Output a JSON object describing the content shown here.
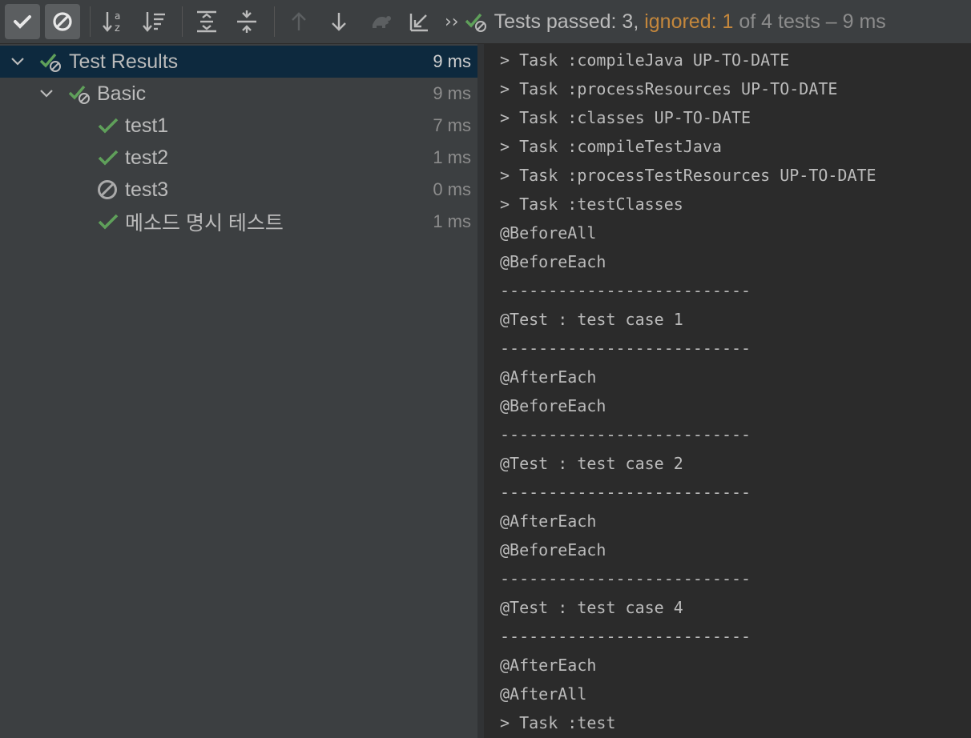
{
  "toolbar": {
    "buttons": [
      {
        "name": "show-passed-button",
        "icon": "checkmark-icon",
        "toggled": true
      },
      {
        "name": "show-ignored-button",
        "icon": "circle-slash-icon",
        "toggled": true
      },
      {
        "name": "sort-alphabetically-button",
        "icon": "sort-az-icon"
      },
      {
        "name": "sort-by-duration-button",
        "icon": "sort-duration-icon"
      },
      {
        "name": "expand-all-button",
        "icon": "expand-all-icon"
      },
      {
        "name": "collapse-all-button",
        "icon": "collapse-all-icon"
      },
      {
        "name": "previous-failed-button",
        "icon": "arrow-up-icon",
        "disabled": true
      },
      {
        "name": "next-failed-button",
        "icon": "arrow-down-icon"
      },
      {
        "name": "import-tests-button",
        "icon": "turtle-icon",
        "disabled": true
      },
      {
        "name": "export-tests-button",
        "icon": "arrow-down-left-icon"
      }
    ],
    "more_glyph": "››",
    "status": {
      "passed_text": "Tests passed: 3,",
      "ignored_text": "ignored: 1",
      "of_text": "of 4 tests –",
      "time_text": "9 ms"
    }
  },
  "tree": {
    "root": {
      "label": "Test Results",
      "time": "9 ms",
      "icon": "passed-with-ignored-icon",
      "selected": true
    },
    "suite": {
      "label": "Basic",
      "time": "9 ms",
      "icon": "passed-with-ignored-icon"
    },
    "tests": [
      {
        "label": "test1",
        "time": "7 ms",
        "icon": "passed-check-icon"
      },
      {
        "label": "test2",
        "time": "1 ms",
        "icon": "passed-check-icon"
      },
      {
        "label": "test3",
        "time": "0 ms",
        "icon": "ignored-icon"
      },
      {
        "label": "메소드 명시 테스트",
        "time": "1 ms",
        "icon": "passed-check-icon"
      }
    ]
  },
  "console": {
    "lines": [
      "> Task :compileJava UP-TO-DATE",
      "> Task :processResources UP-TO-DATE",
      "> Task :classes UP-TO-DATE",
      "> Task :compileTestJava",
      "> Task :processTestResources UP-TO-DATE",
      "> Task :testClasses",
      "@BeforeAll",
      "@BeforeEach",
      "--------------------------",
      "@Test : test case 1",
      "--------------------------",
      "@AfterEach",
      "@BeforeEach",
      "--------------------------",
      "@Test : test case 2",
      "--------------------------",
      "@AfterEach",
      "@BeforeEach",
      "--------------------------",
      "@Test : test case 4",
      "--------------------------",
      "@AfterEach",
      "@AfterAll",
      "> Task :test"
    ]
  },
  "colors": {
    "pass_green": "#5fa05a",
    "ignored_orange": "#c4873c",
    "selection_blue": "#0d293e"
  }
}
